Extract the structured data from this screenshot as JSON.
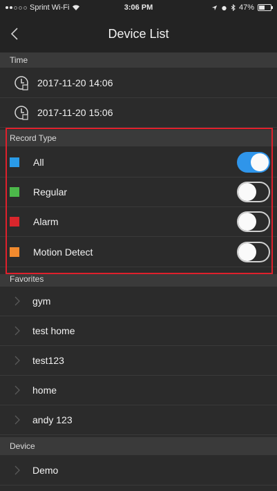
{
  "status_bar": {
    "carrier": "Sprint Wi-Fi",
    "time": "3:06 PM",
    "battery": "47%",
    "battery_level": 0.47
  },
  "nav": {
    "title": "Device List"
  },
  "time_section": {
    "header": "Time",
    "start": "2017-11-20 14:06",
    "end": "2017-11-20 15:06"
  },
  "record_type": {
    "header": "Record Type",
    "items": [
      {
        "label": "All",
        "color": "#2a9be8",
        "enabled": true
      },
      {
        "label": "Regular",
        "color": "#4cb84a",
        "enabled": false
      },
      {
        "label": "Alarm",
        "color": "#d9262c",
        "enabled": false
      },
      {
        "label": "Motion Detect",
        "color": "#f18a2e",
        "enabled": false
      }
    ]
  },
  "favorites": {
    "header": "Favorites",
    "items": [
      "gym",
      "test home",
      "test123",
      "home",
      "andy 123"
    ]
  },
  "device": {
    "header": "Device",
    "items": [
      "Demo"
    ]
  },
  "colors": {
    "highlight_border": "#e0202c",
    "toggle_on": "#2f95ea"
  }
}
